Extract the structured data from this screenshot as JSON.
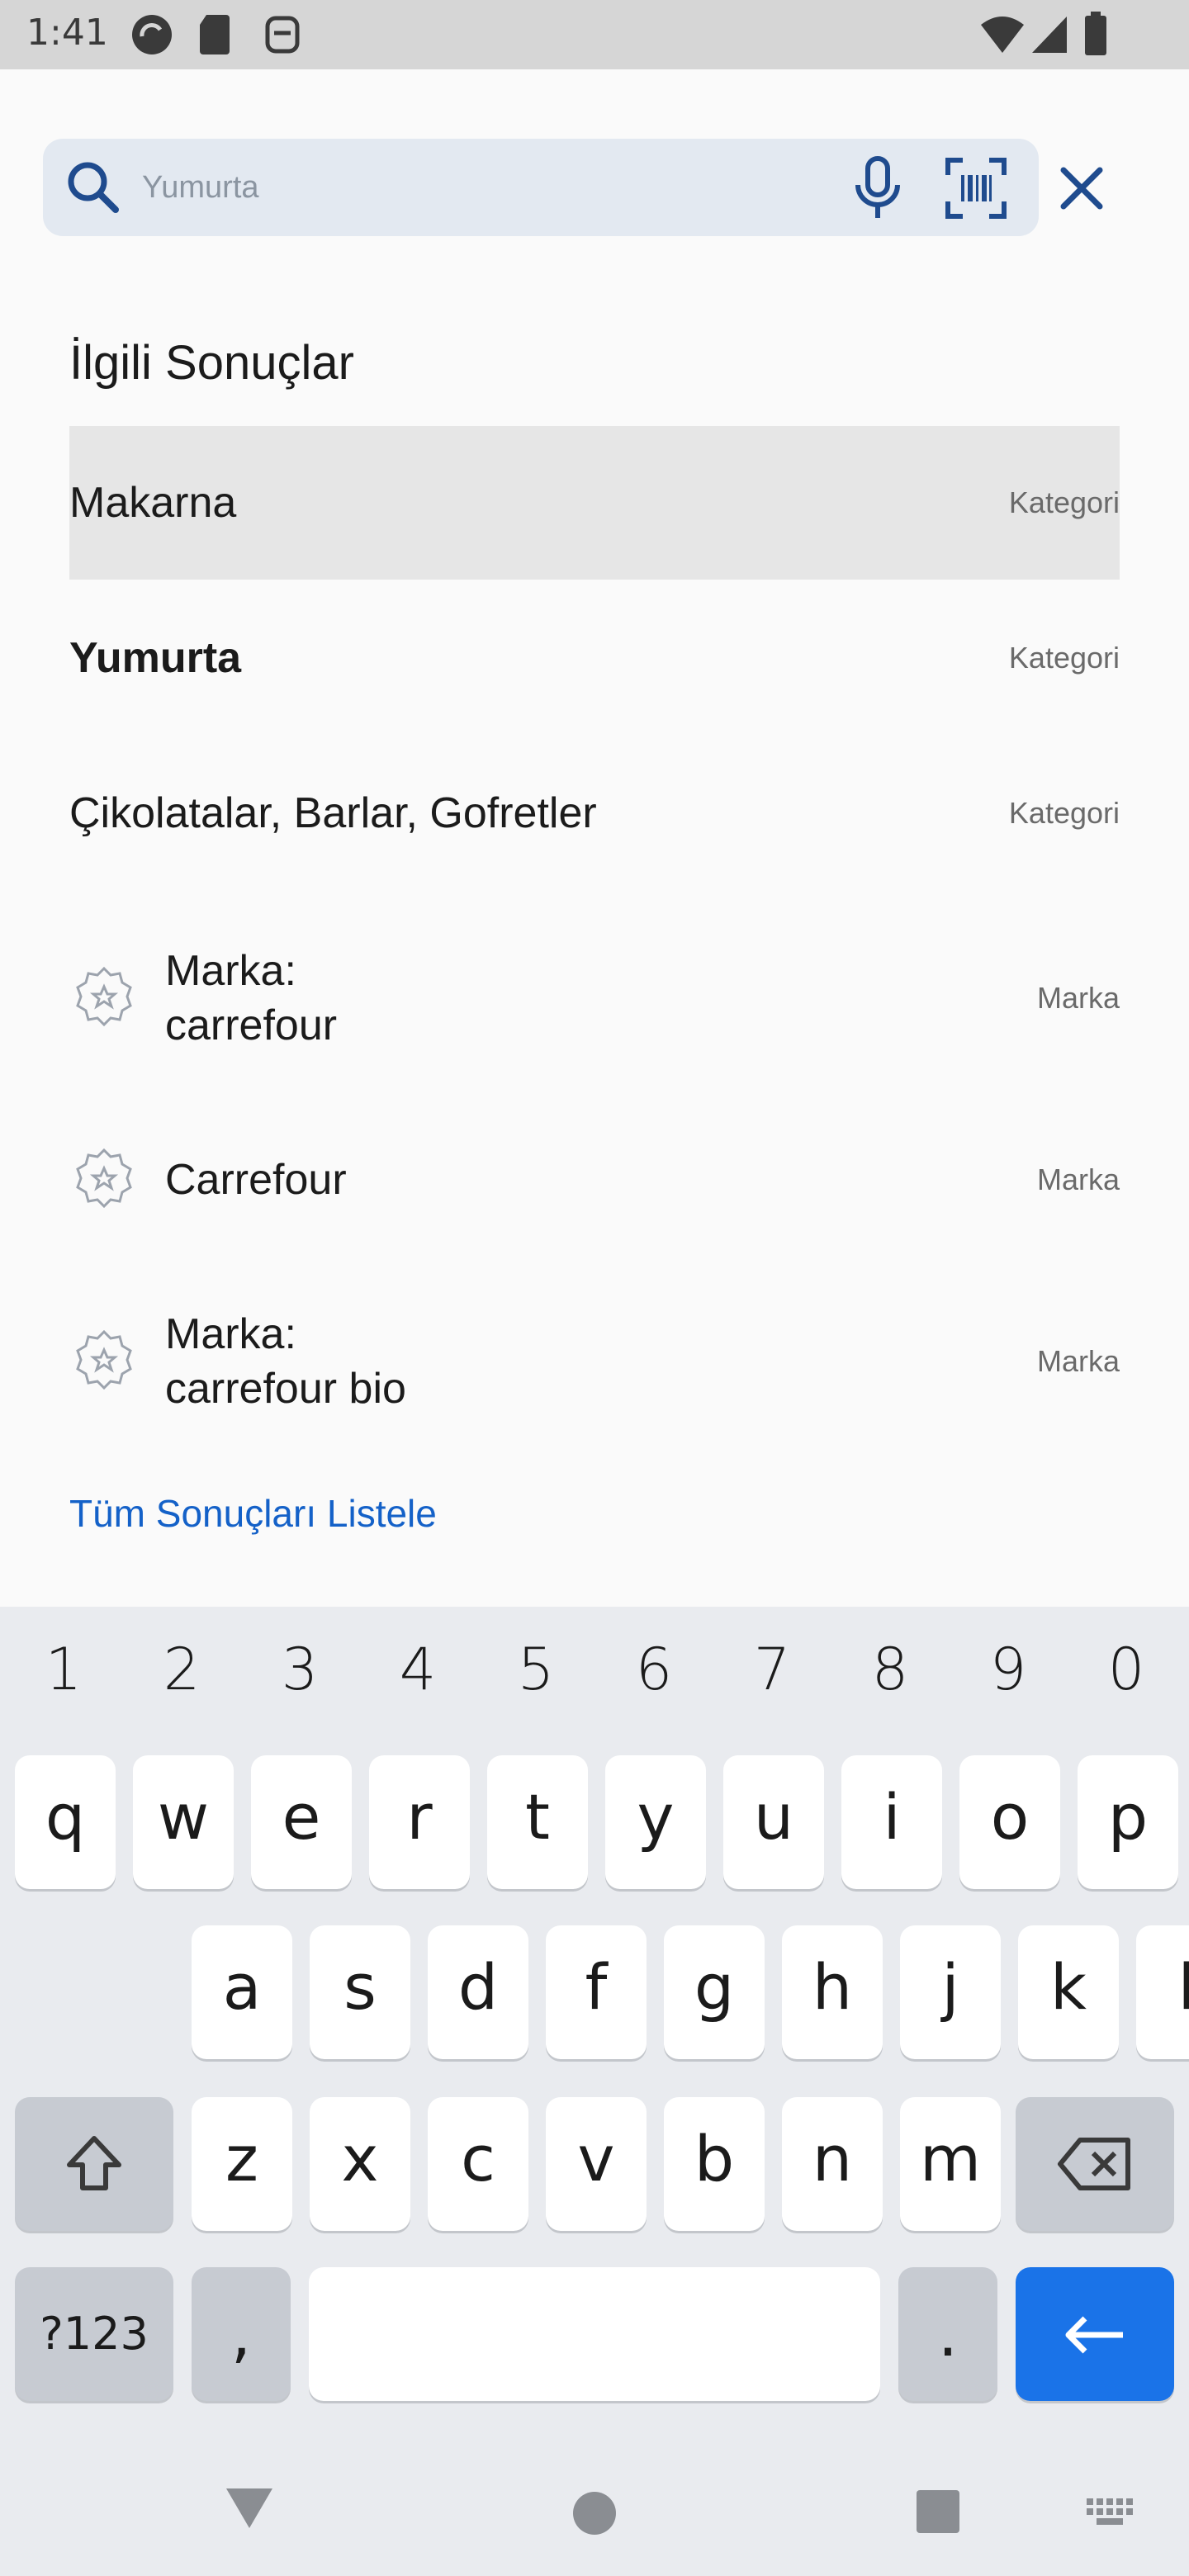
{
  "status": {
    "time": "1:41"
  },
  "search": {
    "placeholder": "Yumurta"
  },
  "section_title": "İlgili Sonuçlar",
  "results": [
    {
      "label": "Makarna",
      "type": "Kategori"
    },
    {
      "label": "Yumurta",
      "type": "Kategori"
    },
    {
      "label": "Çikolatalar, Barlar, Gofretler",
      "type": "Kategori"
    },
    {
      "label_line1": "Marka:",
      "label_line2": "carrefour",
      "type": "Marka"
    },
    {
      "label": "Carrefour",
      "type": "Marka"
    },
    {
      "label_line1": "Marka:",
      "label_line2": "carrefour bio",
      "type": "Marka"
    }
  ],
  "list_all_label": "Tüm Sonuçları Listele",
  "keyboard": {
    "numbers": [
      "1",
      "2",
      "3",
      "4",
      "5",
      "6",
      "7",
      "8",
      "9",
      "0"
    ],
    "row1": [
      "q",
      "w",
      "e",
      "r",
      "t",
      "y",
      "u",
      "i",
      "o",
      "p"
    ],
    "row2": [
      "a",
      "s",
      "d",
      "f",
      "g",
      "h",
      "j",
      "k",
      "l"
    ],
    "row3": [
      "z",
      "x",
      "c",
      "v",
      "b",
      "n",
      "m"
    ],
    "symbols_label": "?123",
    "comma": ",",
    "period": "."
  },
  "colors": {
    "accent": "#1a73e8",
    "link": "#1461c8",
    "icon": "#1f4b8e"
  }
}
